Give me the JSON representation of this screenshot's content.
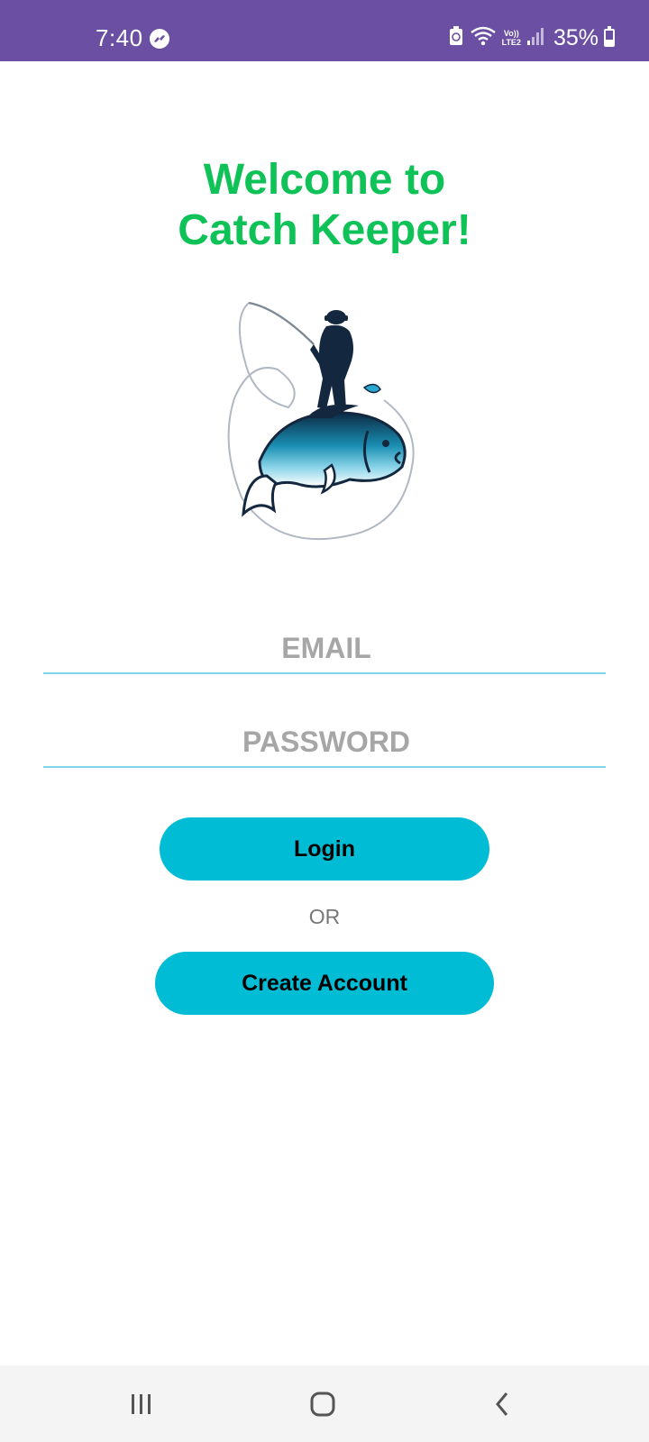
{
  "status_bar": {
    "time": "7:40",
    "battery_percent": "35%",
    "battery_level": 0.35,
    "network_label_top": "Vo))",
    "network_label_bottom": "LTE2",
    "icons": [
      "messenger-icon",
      "battery-saver-icon",
      "wifi-icon",
      "volte-lte-icon",
      "signal-icon",
      "battery-icon"
    ],
    "background_color": "#6a4fa3"
  },
  "welcome": {
    "line1": "Welcome to",
    "line2": "Catch Keeper!",
    "color": "#0fc257"
  },
  "logo": {
    "icon": "fisherman-fish-logo"
  },
  "form": {
    "email_placeholder": "EMAIL",
    "email_value": "",
    "password_placeholder": "PASSWORD",
    "password_value": "",
    "underline_color": "#7fd6ec"
  },
  "actions": {
    "login_label": "Login",
    "or_label": "OR",
    "create_account_label": "Create Account",
    "button_color": "#00bcd4"
  },
  "nav_bar": {
    "icons": [
      "recents-icon",
      "home-icon",
      "back-icon"
    ]
  }
}
